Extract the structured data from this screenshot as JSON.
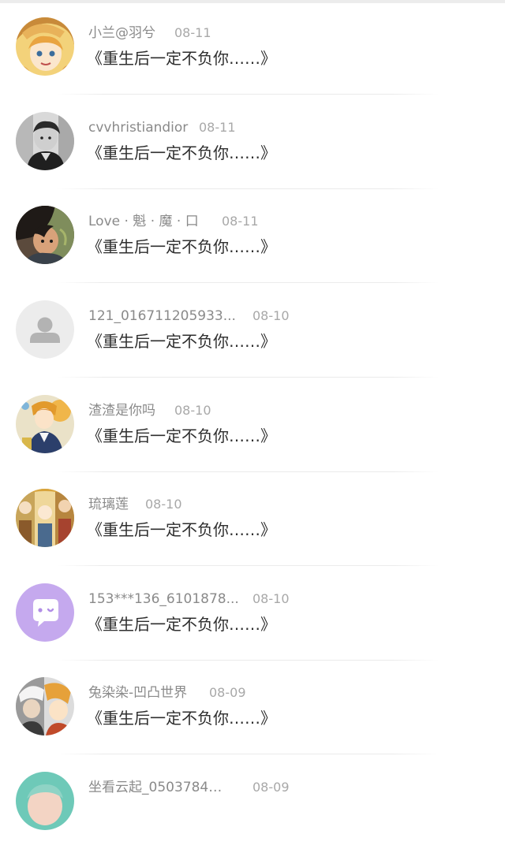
{
  "comments": [
    {
      "user": "小兰@羽兮",
      "date": "08-11",
      "message": "《重生后一定不负你……》",
      "avatar_icon": "anime-girl-avatar-icon"
    },
    {
      "user": "cvvhristiandior",
      "date": "08-11",
      "message": "《重生后一定不负你……》",
      "avatar_icon": "photo-boy-avatar-icon"
    },
    {
      "user": "Love · 魁 · 魔 · 口",
      "date": "08-11",
      "message": "《重生后一定不负你……》",
      "avatar_icon": "anime-boy-avatar-icon"
    },
    {
      "user": "121_016711205933...",
      "date": "08-10",
      "message": "《重生后一定不负你……》",
      "avatar_icon": "default-person-avatar-icon"
    },
    {
      "user": "渣渣是你吗",
      "date": "08-10",
      "message": "《重生后一定不负你……》",
      "avatar_icon": "anime-character-avatar-icon"
    },
    {
      "user": "琉璃莲",
      "date": "08-10",
      "message": "《重生后一定不负你……》",
      "avatar_icon": "anime-group-avatar-icon"
    },
    {
      "user": "153***136_6101878...",
      "date": "08-10",
      "message": "《重生后一定不负你……》",
      "avatar_icon": "chat-bubble-avatar-icon"
    },
    {
      "user": "兔染染-凹凸世界",
      "date": "08-09",
      "message": "《重生后一定不负你……》",
      "avatar_icon": "anime-duo-avatar-icon"
    },
    {
      "user": "坐看云起_0503784…",
      "date": "08-09",
      "message": "",
      "avatar_icon": "photo-child-avatar-icon"
    }
  ]
}
